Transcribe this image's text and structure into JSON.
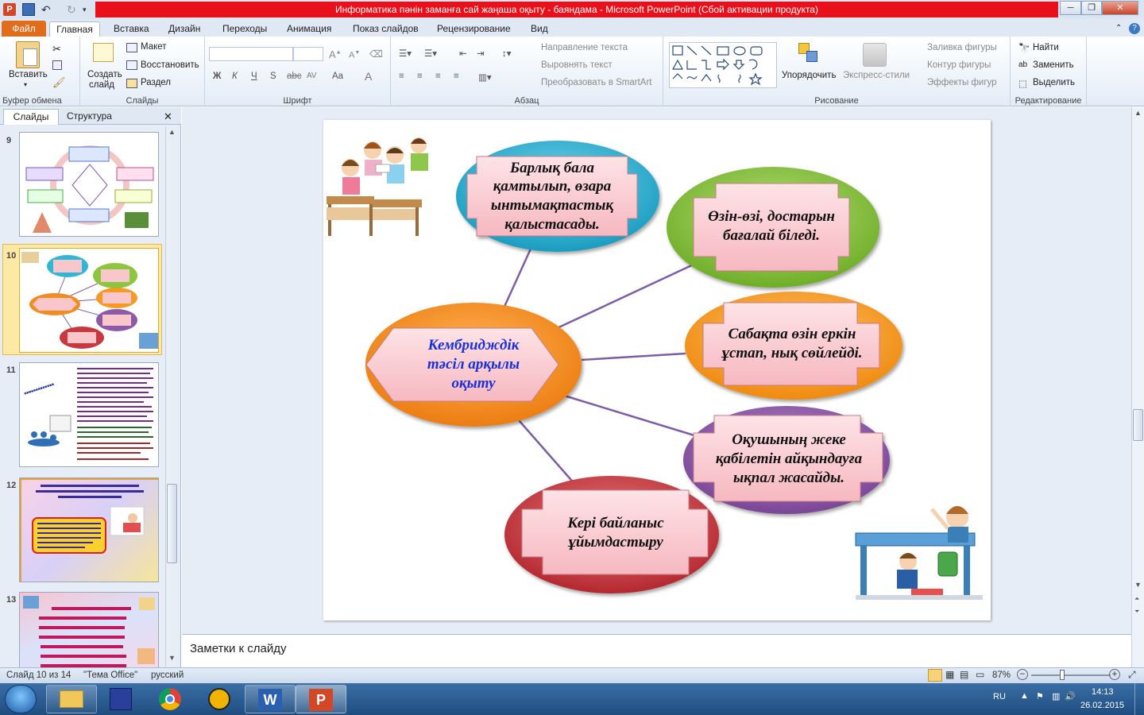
{
  "window": {
    "title": "Информатика пәнін заманға сай жаңаша оқыту - баяндама  -  Microsoft PowerPoint (Сбой активации продукта)"
  },
  "tabs": [
    "Файл",
    "Главная",
    "Вставка",
    "Дизайн",
    "Переходы",
    "Анимация",
    "Показ слайдов",
    "Рецензирование",
    "Вид"
  ],
  "ribbon": {
    "clipboard": {
      "paste": "Вставить",
      "label": "Буфер обмена"
    },
    "slides": {
      "new_slide_line1": "Создать",
      "new_slide_line2": "слайд",
      "layout": "Макет",
      "reset": "Восстановить",
      "section": "Раздел",
      "label": "Слайды"
    },
    "font": {
      "label": "Шрифт",
      "buttons": [
        "Ж",
        "К",
        "Ч",
        "S",
        "abc",
        "AV",
        "Aa",
        "A"
      ]
    },
    "paragraph": {
      "text_direction": "Направление текста",
      "align_text": "Выровнять текст",
      "smartart": "Преобразовать в SmartArt",
      "label": "Абзац"
    },
    "drawing": {
      "arrange": "Упорядочить",
      "quick_styles": "Экспресс-стили",
      "shape_fill": "Заливка фигуры",
      "shape_outline": "Контур фигуры",
      "shape_effects": "Эффекты фигур",
      "label": "Рисование"
    },
    "editing": {
      "find": "Найти",
      "replace": "Заменить",
      "select": "Выделить",
      "label": "Редактирование"
    }
  },
  "left_pane": {
    "tab_slides": "Слайды",
    "tab_outline": "Структура",
    "slide_numbers": [
      "9",
      "10",
      "11",
      "12",
      "13"
    ]
  },
  "slide": {
    "center": "Кембриджді\u0003к\nтәсіл арқылы\nоқыту",
    "bubbles": [
      "Барлық бала\nқамтылып, өзара\nынтымақтастық\nқалыстасады.",
      "Өзін-өзі, достарын\nбағалай біледі.",
      "Сабақта өзін еркін\nұстап, нық сөйлейді.",
      "Оқушының жеке\nқабілетін айқындауға\nықпал жасайды.",
      "Кері байланыс\nұйымдастыру"
    ]
  },
  "notes": {
    "placeholder": "Заметки к слайду"
  },
  "status": {
    "slide": "Слайд 10 из 14",
    "theme": "\"Тема Office\"",
    "lang": "русский",
    "zoom": "87%"
  },
  "taskbar": {
    "lang": "RU",
    "time": "14:13",
    "date": "26.02.2015"
  },
  "colors": {
    "ppt_red": "#e8101a",
    "file_tab": "#e06d1a",
    "center_ellipse": "#f28c1e",
    "bubble_blue": "#2eb8d6",
    "bubble_green": "#8cc63f",
    "bubble_orange": "#f59a23",
    "bubble_purple": "#8e5aa8",
    "bubble_red": "#c9383f",
    "label_pink": "#f9c6cc",
    "connector": "#7b5ea7"
  }
}
